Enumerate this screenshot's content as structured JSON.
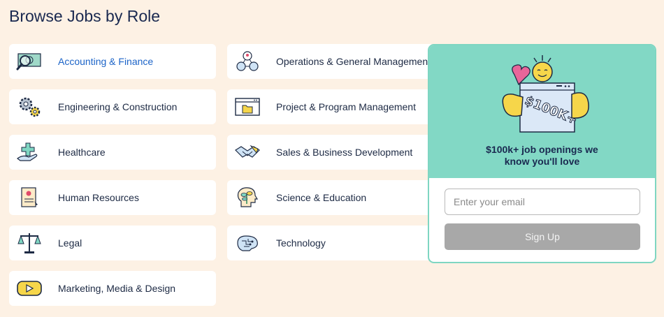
{
  "page": {
    "title": "Browse Jobs by Role"
  },
  "roles": [
    {
      "label": "Accounting & Finance",
      "icon": "money-magnifier-icon"
    },
    {
      "label": "Engineering & Construction",
      "icon": "gears-icon"
    },
    {
      "label": "Healthcare",
      "icon": "medical-cross-hand-icon"
    },
    {
      "label": "Human Resources",
      "icon": "resume-document-icon"
    },
    {
      "label": "Legal",
      "icon": "justice-scale-icon"
    },
    {
      "label": "Marketing, Media & Design",
      "icon": "play-button-icon"
    },
    {
      "label": "Operations & General Management",
      "icon": "network-people-icon"
    },
    {
      "label": "Project & Program Management",
      "icon": "browser-folder-icon"
    },
    {
      "label": "Sales & Business Development",
      "icon": "handshake-icon"
    },
    {
      "label": "Science & Education",
      "icon": "head-plant-icon"
    },
    {
      "label": "Technology",
      "icon": "brain-circuit-icon"
    }
  ],
  "promo": {
    "heading_line1": "$100k+ job openings we",
    "heading_line2": "know you'll love",
    "art_text": "$100K+",
    "email_placeholder": "Enter your email",
    "signup_label": "Sign Up"
  },
  "colors": {
    "background": "#fdf1e4",
    "promo_accent": "#82d8c5",
    "link_active": "#1c64c8",
    "signup_disabled": "#a8a8a8"
  }
}
